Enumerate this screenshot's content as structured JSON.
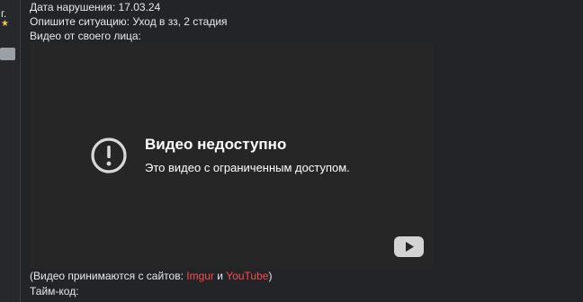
{
  "sidebar": {
    "fragment_text": "г.",
    "star_glyph": "★"
  },
  "post": {
    "violation_date_line": "Дата нарушения: 17.03.24",
    "situation_line": "Опишите ситуацию: Уход в зз, 2 стадия",
    "video_label": "Видео от своего лица:",
    "sites_prefix": "(Видео принимаются с сайтов: ",
    "sites_link1": "Imgur",
    "sites_and": " и ",
    "sites_link2": "YouTube",
    "sites_suffix": ")",
    "timecode_label": "Тайм-код:"
  },
  "video": {
    "error_title": "Видео недоступно",
    "error_message": "Это видео с ограниченным доступом.",
    "error_icon": "exclamation-circle-icon",
    "logo_icon": "youtube-logo-icon"
  },
  "colors": {
    "background": "#232427",
    "player_bg": "#262626",
    "link": "#ff4a4a",
    "text": "#e9e9ea"
  }
}
